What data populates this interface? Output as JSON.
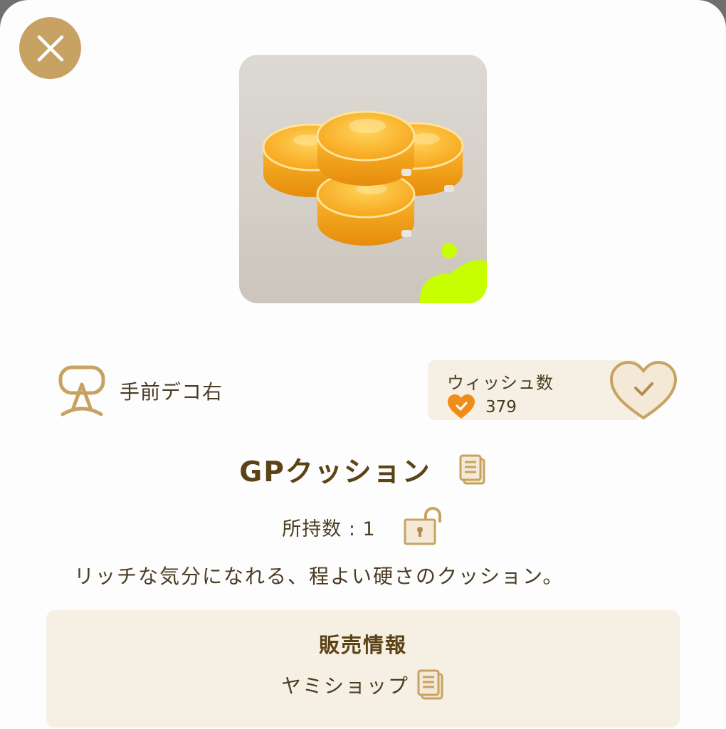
{
  "item": {
    "category": "手前デコ右",
    "name": "GPクッション",
    "owned_text": "所持数 : 1",
    "description": "リッチな気分になれる、程よい硬さのクッション。"
  },
  "wish": {
    "title": "ウィッシュ数",
    "count": "379"
  },
  "sales": {
    "title": "販売情報",
    "shop": "ヤミショップ"
  },
  "colors": {
    "accent_gold": "#c8a262",
    "text_brown": "#4a3b22",
    "panel_beige": "#f6efe3",
    "badge_lime": "#c8ff00",
    "heart_orange": "#f08c1a"
  },
  "icons": [
    "close-icon",
    "decoration-stand-icon",
    "heart-check-icon",
    "wish-heart-button-icon",
    "copy-icon",
    "unlock-icon"
  ]
}
